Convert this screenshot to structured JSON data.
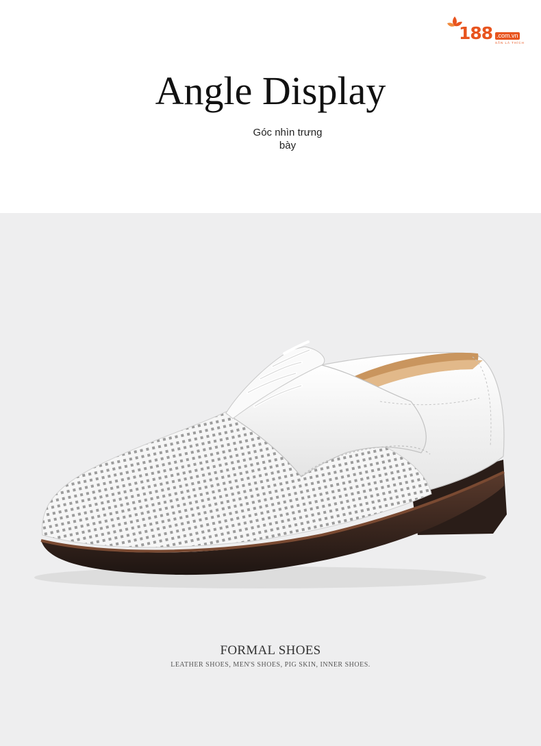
{
  "brand": {
    "number": "188",
    "domain": ".com.vn",
    "tagline": "SẴN LÀ THÍCH",
    "accent_color": "#e8541e"
  },
  "header": {
    "title": "Angle Display",
    "subtitle": "Góc nhìn trưng bày"
  },
  "product": {
    "image_icon": "white-perforated-derby-shoe",
    "caption_title": "FORMAL SHOES",
    "caption_tags": "LEATHER SHOES, MEN'S SHOES, PIG SKIN, INNER SHOES."
  },
  "colors": {
    "stage_background": "#eeeeef",
    "shoe_leather": "#f7f7f7",
    "sole": "#2a1d18",
    "lining": "#c9955e"
  }
}
